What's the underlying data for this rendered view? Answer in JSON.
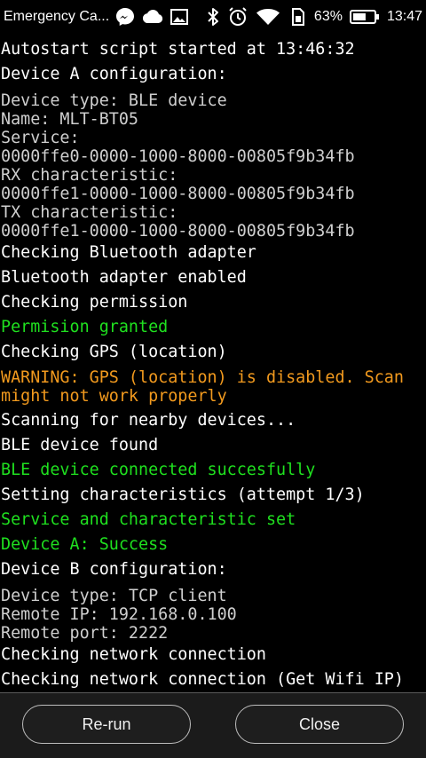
{
  "status_bar": {
    "notification_title": "Emergency Ca...",
    "battery_percent": "63%",
    "time": "13:47",
    "icons": [
      "messenger-icon",
      "cloud-icon",
      "image-icon",
      "bluetooth-icon",
      "alarm-icon",
      "wifi-icon",
      "sim-card-icon",
      "battery-icon"
    ]
  },
  "log": {
    "l01": "Autostart script started at 13:46:32",
    "l02": "Device A configuration:",
    "a_type": "Device type: BLE device",
    "a_name": "Name: MLT-BT05",
    "a_service_label": "Service:",
    "a_service": "0000ffe0-0000-1000-8000-00805f9b34fb",
    "a_rx_label": "RX characteristic:",
    "a_rx": "0000ffe1-0000-1000-8000-00805f9b34fb",
    "a_tx_label": "TX characteristic:",
    "a_tx": "0000ffe1-0000-1000-8000-00805f9b34fb",
    "l03": "Checking Bluetooth adapter",
    "l04": "Bluetooth adapter enabled",
    "l05": "Checking permission",
    "l06": "Permision granted",
    "l07": "Checking GPS (location)",
    "l08": "WARNING: GPS (location) is disabled. Scan might not work properly",
    "l09": "Scanning for nearby devices...",
    "l10": "BLE device found",
    "l11": "BLE device connected succesfully",
    "l12": "Setting characteristics (attempt 1/3)",
    "l13": "Service and characteristic set",
    "l14": "Device A: Success",
    "l15": "Device B configuration:",
    "b_type": "Device type: TCP client",
    "b_ip": "Remote IP: 192.168.0.100",
    "b_port": "Remote port: 2222",
    "l16": "Checking network connection",
    "l17": "Checking network connection (Get Wifi IP)"
  },
  "colors": {
    "normal": "#ffffff",
    "detail": "#cfcfcf",
    "success": "#1fe01f",
    "warning": "#f29a1e"
  },
  "buttons": {
    "rerun": "Re-run",
    "close": "Close"
  }
}
